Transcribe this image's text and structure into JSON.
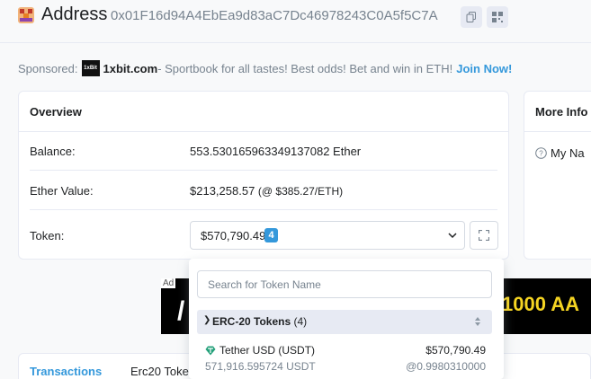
{
  "header": {
    "title": "Address",
    "address": "0x01F16d94A4EbEa9d83aC7Dc46978243C0A5f5C7A",
    "copy_icon": "copy-icon",
    "qr_icon": "qr-code-icon"
  },
  "sponsor": {
    "label": "Sponsored:",
    "logo_text": "1xBit",
    "brand": "1xbit.com",
    "text": " - Sportbook for all tastes! Best odds! Bet and win in ETH!",
    "cta": "Join Now!"
  },
  "overview": {
    "title": "Overview",
    "balance_label": "Balance:",
    "balance_value": "553.530165963349137082 Ether",
    "ether_value_label": "Ether Value:",
    "ether_value": "$213,258.57",
    "ether_price": "(@ $385.27/ETH)",
    "token_label": "Token:",
    "token_value": "$570,790.49",
    "token_count": "4"
  },
  "more_info": {
    "title": "More Info",
    "my_name_tag": "My Na"
  },
  "ads": {
    "left_tag": "Ad",
    "left_glyph": "/",
    "right_text": "1000 AA"
  },
  "dropdown": {
    "search_placeholder": "Search for Token Name",
    "group_label": "ERC-20 Tokens",
    "group_count": "(4)",
    "token": {
      "name": "Tether USD (USDT)",
      "value": "$570,790.49",
      "quantity": "571,916.595724 USDT",
      "price": "@0.9980310000"
    }
  },
  "tabs": [
    {
      "label": "Transactions"
    },
    {
      "label": "Erc20 Toke"
    }
  ],
  "colors": {
    "accent": "#3498db",
    "tether": "#26a17b",
    "muted": "#77838f"
  }
}
